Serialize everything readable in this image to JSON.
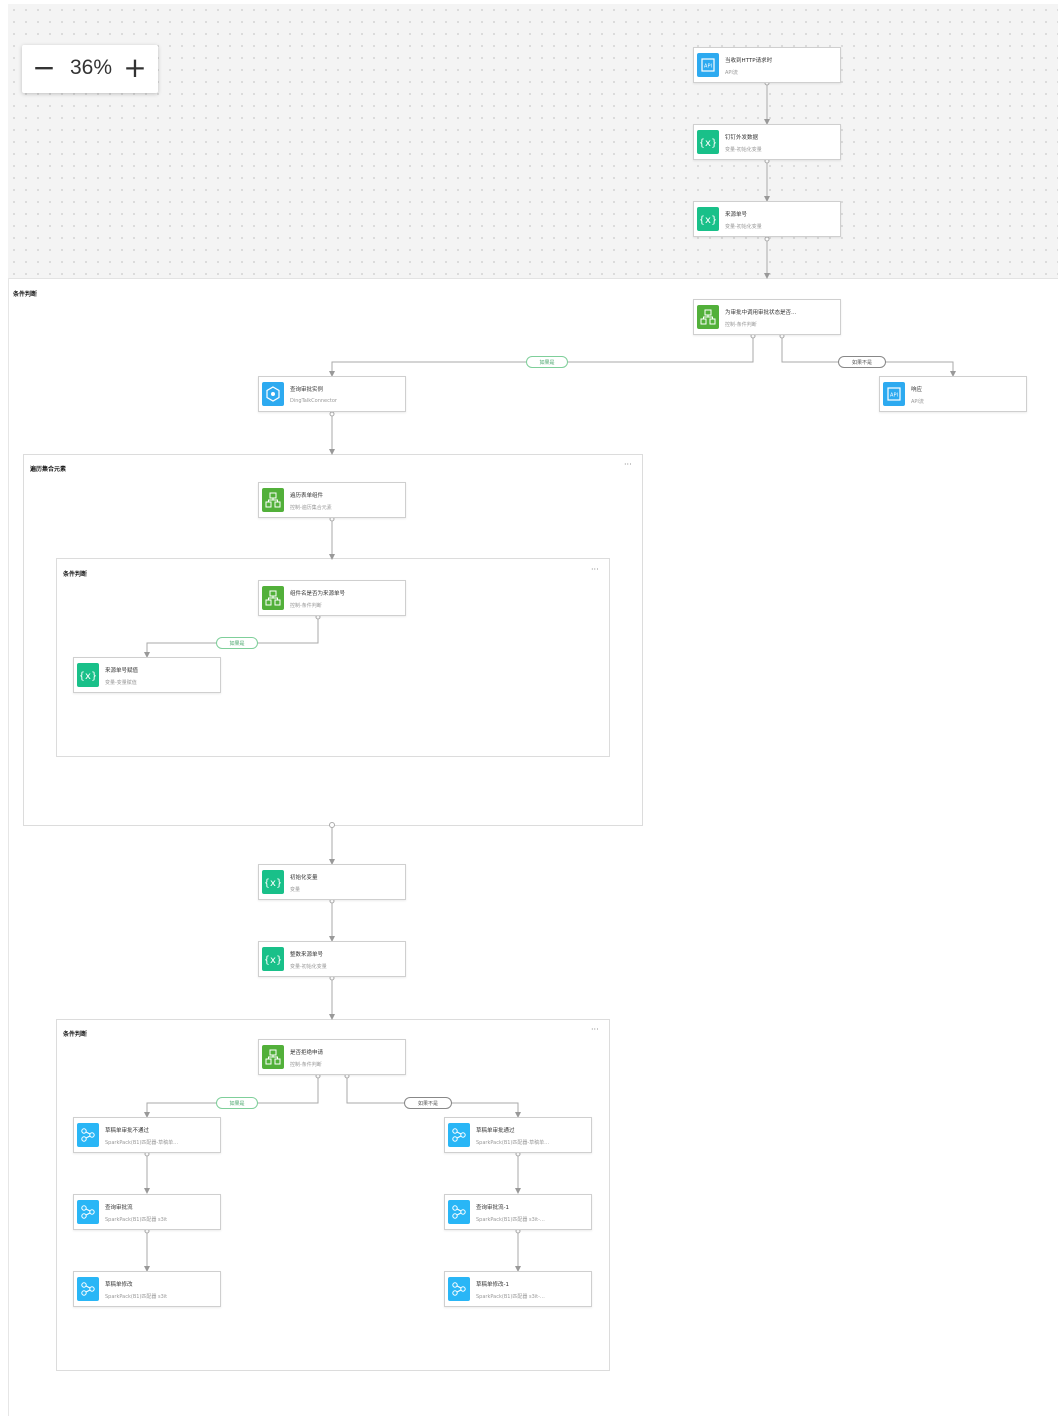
{
  "zoom": {
    "minus_label": "−",
    "value": "36%",
    "plus_label": "+"
  },
  "colors": {
    "api": "#2daaf0",
    "variable": "#19c089",
    "control": "#52b03a",
    "spark": "#29b6f6",
    "yes_branch": "#47a56a"
  },
  "frames": {
    "outer_condition": {
      "label": "条件判断"
    },
    "loop": {
      "label": "遍历集合元素",
      "more": "···"
    },
    "inner_condition": {
      "label": "条件判断",
      "more": "···"
    },
    "bottom_condition": {
      "label": "条件判断",
      "more": "···"
    }
  },
  "branches": {
    "yes": "如果是",
    "no": "如果不是"
  },
  "nodes": {
    "http_request": {
      "title": "当收到HTTP请求时",
      "subtitle": "API流",
      "icon": "api-icon"
    },
    "dingtalk_form": {
      "title": "钉钉外发数据",
      "subtitle": "变量-初始化变量",
      "icon": "variable-icon"
    },
    "source_no": {
      "title": "来源单号",
      "subtitle": "变量-初始化变量",
      "icon": "variable-icon"
    },
    "check_status": {
      "title": "为审批中调用审批状态是否…",
      "subtitle": "控制-条件判断",
      "icon": "control-icon"
    },
    "query_instance": {
      "title": "查询审批实例",
      "subtitle": "DingTalkConnector",
      "icon": "connector-icon"
    },
    "return_node": {
      "title": "响应",
      "subtitle": "API流",
      "icon": "api-icon"
    },
    "loop_form": {
      "title": "遍历表单组件",
      "subtitle": "控制-遍历集合元素",
      "icon": "control-icon"
    },
    "check_component": {
      "title": "组件名是否为来源单号",
      "subtitle": "控制-条件判断",
      "icon": "control-icon"
    },
    "assign_source": {
      "title": "来源单号赋值",
      "subtitle": "变量-变量赋值",
      "icon": "variable-icon"
    },
    "init_var": {
      "title": "初始化变量",
      "subtitle": "变量",
      "icon": "variable-icon"
    },
    "int_source": {
      "title": "整数来源单号",
      "subtitle": "变量-初始化变量",
      "icon": "variable-icon"
    },
    "check_reject": {
      "title": "是否拒绝申请",
      "subtitle": "控制-条件判断",
      "icon": "control-icon"
    },
    "left_1": {
      "title": "草稿单审批不通过",
      "subtitle": "SparkPack(B1)匹配器-草稿单…",
      "icon": "spark-icon"
    },
    "left_2": {
      "title": "查询审批流",
      "subtitle": "SparkPack(B1)匹配器 s3it",
      "icon": "spark-icon"
    },
    "left_3": {
      "title": "草稿单修改",
      "subtitle": "SparkPack(B1)匹配器 s3it",
      "icon": "spark-icon"
    },
    "right_1": {
      "title": "草稿单审批通过",
      "subtitle": "SparkPack(B1)匹配器-草稿单…",
      "icon": "spark-icon"
    },
    "right_2": {
      "title": "查询审批流-1",
      "subtitle": "SparkPack(B1)匹配器 s3it-…",
      "icon": "spark-icon"
    },
    "right_3": {
      "title": "草稿单修改-1",
      "subtitle": "SparkPack(B1)匹配器 s3it-…",
      "icon": "spark-icon"
    }
  }
}
